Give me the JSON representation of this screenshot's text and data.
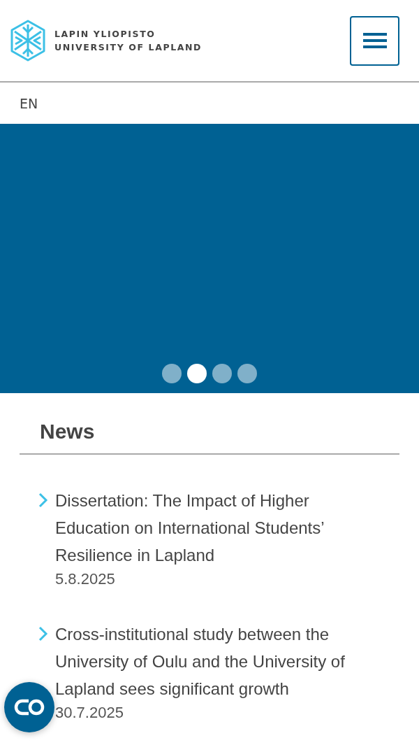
{
  "header": {
    "logo_line_1": "LAPIN YLIOPISTO",
    "logo_line_2": "UNIVERSITY OF LAPLAND"
  },
  "language": "EN",
  "carousel": {
    "dots": [
      {
        "selected": false
      },
      {
        "selected": true
      },
      {
        "selected": false
      },
      {
        "selected": false
      }
    ]
  },
  "news": {
    "title": "News",
    "items": [
      {
        "title": "Dissertation: The Impact of Higher Education on International Students’ Resilience in Lapland",
        "date": "5.8.2025"
      },
      {
        "title": "Cross-institutional study between the University of Oulu and the University of Lapland sees significant growth",
        "date": "30.7.2025"
      }
    ]
  }
}
